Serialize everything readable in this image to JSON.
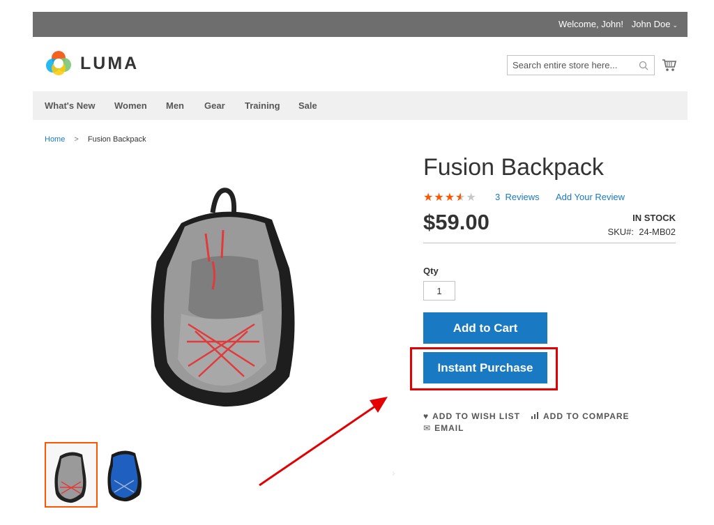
{
  "topbar": {
    "welcome": "Welcome, John!",
    "account": "John Doe"
  },
  "header": {
    "logo_text": "LUMA",
    "search_placeholder": "Search entire store here..."
  },
  "nav": {
    "items": [
      "What's New",
      "Women",
      "Men",
      "Gear",
      "Training",
      "Sale"
    ]
  },
  "breadcrumb": {
    "home": "Home",
    "separator": ">",
    "current": "Fusion Backpack"
  },
  "product": {
    "title": "Fusion Backpack",
    "rating_stars": 3.5,
    "rating_max": 5,
    "reviews_count": "3",
    "reviews_label": "Reviews",
    "add_review": "Add Your Review",
    "price": "$59.00",
    "stock": "IN STOCK",
    "sku_label": "SKU#:",
    "sku": "24-MB02",
    "qty_label": "Qty",
    "qty_value": "1",
    "add_to_cart": "Add to Cart",
    "instant_purchase": "Instant Purchase",
    "wishlist": "ADD TO WISH LIST",
    "compare": "ADD TO COMPARE",
    "email": "EMAIL"
  },
  "colors": {
    "accent": "#1979c3",
    "rating": "#ff5501",
    "annotation": "#e20000",
    "topbar": "#6e6e6e"
  }
}
